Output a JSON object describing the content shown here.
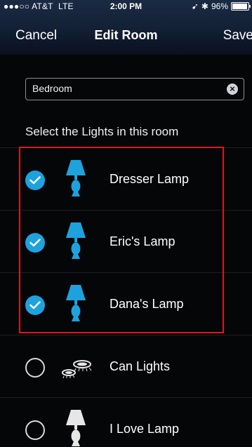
{
  "status_bar": {
    "carrier": "●●●○○ AT&T",
    "network": "LTE",
    "time": "2:00 PM",
    "battery_text": "96%",
    "battery_level": 0.96
  },
  "nav": {
    "cancel_label": "Cancel",
    "title": "Edit Room",
    "save_label": "Save"
  },
  "room_name_field": {
    "value": "Bedroom"
  },
  "section_label": "Select the Lights in this room",
  "lights": [
    {
      "name": "Dresser Lamp",
      "selected": true,
      "icon": "table-lamp-icon"
    },
    {
      "name": "Eric's Lamp",
      "selected": true,
      "icon": "table-lamp-icon"
    },
    {
      "name": "Dana's Lamp",
      "selected": true,
      "icon": "table-lamp-icon"
    },
    {
      "name": "Can Lights",
      "selected": false,
      "icon": "can-lights-icon"
    },
    {
      "name": "I Love Lamp",
      "selected": false,
      "icon": "table-lamp-icon"
    }
  ],
  "colors": {
    "accent": "#1ea2de",
    "highlight_border": "#e0141f"
  }
}
